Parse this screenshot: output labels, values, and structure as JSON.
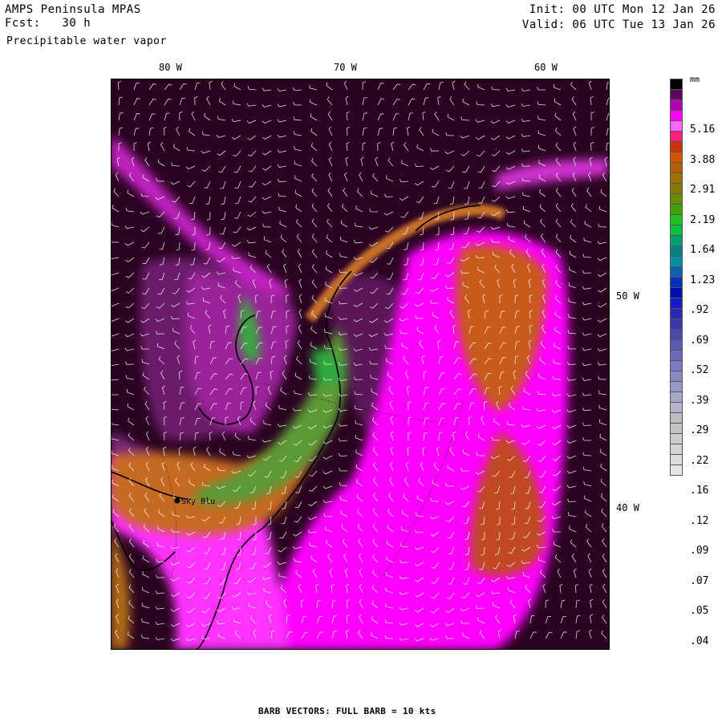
{
  "header": {
    "model": "AMPS Peninsula MPAS",
    "forecast": "Fcst:   30 h",
    "field": "Precipitable water vapor",
    "init": "Init: 00 UTC Mon 12 Jan 26",
    "valid": "Valid: 06 UTC Tue 13 Jan 26"
  },
  "longitude_labels": [
    "80 W",
    "70 W",
    "60 W"
  ],
  "latitude_labels": [
    "50 W",
    "40 W"
  ],
  "station": {
    "name": "Sky Blu"
  },
  "colorbar": {
    "unit": "mm",
    "labels": [
      "5.16",
      "3.88",
      "2.91",
      "2.19",
      "1.64",
      "1.23",
      ".92",
      ".69",
      ".52",
      ".39",
      ".29",
      ".22",
      ".16",
      ".12",
      ".09",
      ".07",
      ".05",
      ".04"
    ],
    "colors": [
      "#000000",
      "#5a0a5a",
      "#b000b0",
      "#ff00ff",
      "#ff66ff",
      "#ff1f7f",
      "#cc3300",
      "#d45500",
      "#b35f00",
      "#a07200",
      "#847a00",
      "#668c00",
      "#3fa400",
      "#21bf21",
      "#00c040",
      "#00a070",
      "#008080",
      "#0090a0",
      "#1060b0",
      "#0030c0",
      "#0010b0",
      "#1818c8",
      "#2a2ab0",
      "#3838a8",
      "#4a4aa8",
      "#5a5ab0",
      "#6a6ab8",
      "#7a7ac0",
      "#8888c4",
      "#9898c8",
      "#a8a8c8",
      "#b4b4cc",
      "#bcbcc4",
      "#c4c4c4",
      "#cccccc",
      "#d4d4d4",
      "#dcdcdc",
      "#e6e6e6"
    ]
  },
  "footer": "BARB VECTORS:  FULL BARB = 10 kts",
  "colors": {
    "background_dark": "#2a0320",
    "moist_magenta": "#ff00ff",
    "orange": "#c85a1e",
    "green": "#4aa43c",
    "coast": "#000000"
  }
}
